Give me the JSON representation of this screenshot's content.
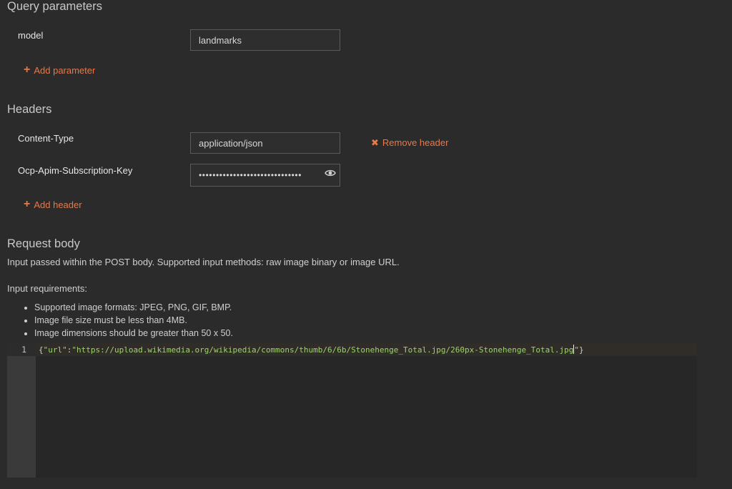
{
  "query_parameters": {
    "title": "Query parameters",
    "params": [
      {
        "name": "model",
        "value": "landmarks"
      }
    ],
    "add_label": "Add parameter"
  },
  "headers": {
    "title": "Headers",
    "items": [
      {
        "name": "Content-Type",
        "value": "application/json",
        "remove_label": "Remove header"
      },
      {
        "name": "Ocp-Apim-Subscription-Key",
        "value": "••••••••••••••••••••••••••••••"
      }
    ],
    "add_label": "Add header"
  },
  "request_body": {
    "title": "Request body",
    "description": "Input passed within the POST body. Supported input methods: raw image binary or image URL.",
    "requirements_heading": "Input requirements:",
    "requirements": [
      "Supported image formats: JPEG, PNG, GIF, BMP.",
      "Image file size must be less than 4MB.",
      "Image dimensions should be greater than 50 x 50."
    ],
    "editor": {
      "line_number": "1",
      "code_open": "{",
      "code_key": "\"url\"",
      "code_colon": ":",
      "code_value": "\"https://upload.wikimedia.org/wikipedia/commons/thumb/6/6b/Stonehenge_Total.jpg/260px-Stonehenge_Total.jpg",
      "code_quote": "\"",
      "code_close": "}"
    }
  },
  "colors": {
    "background": "#2b2b2b",
    "accent": "#e8794a",
    "code_string": "#9cd36b",
    "field_border": "#5a5a5a"
  }
}
